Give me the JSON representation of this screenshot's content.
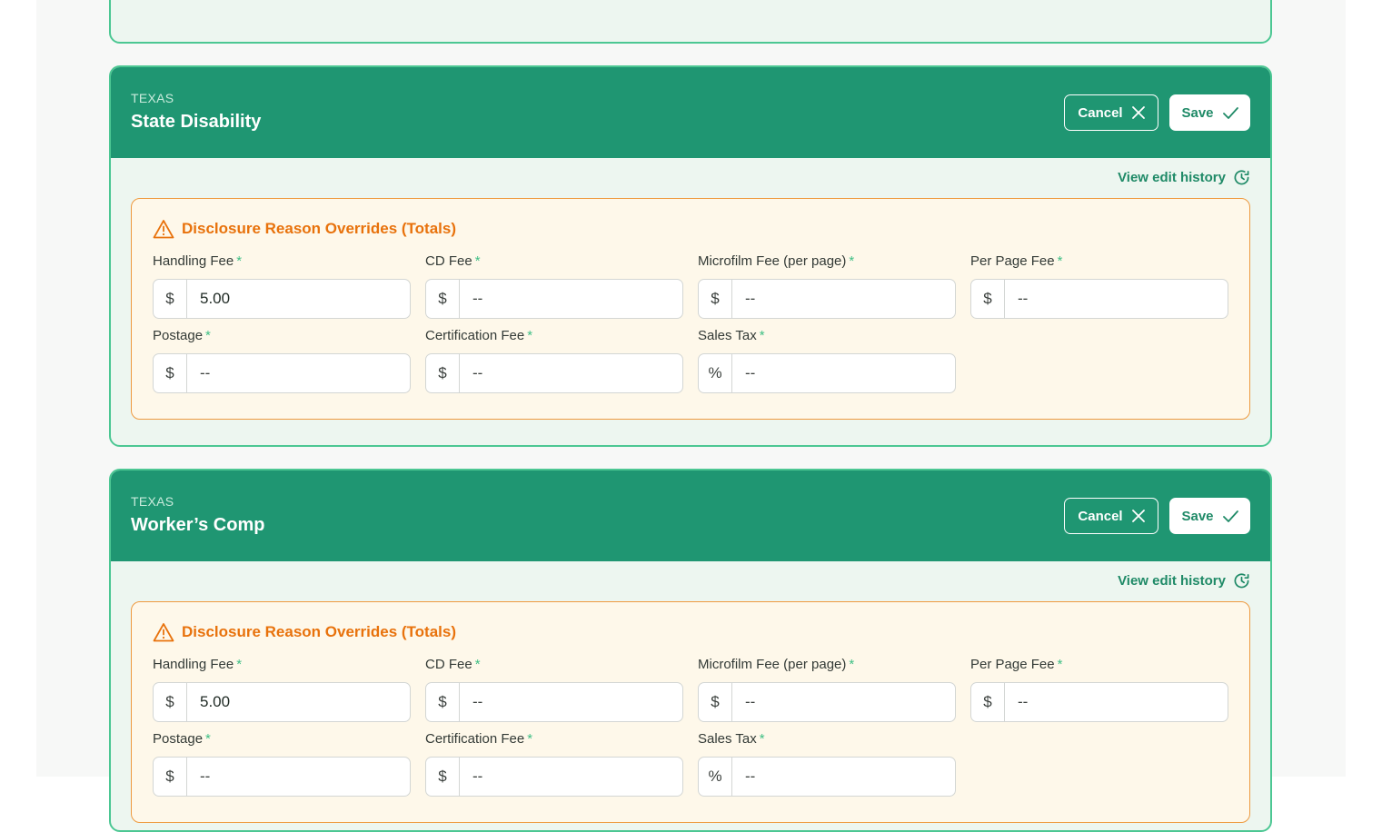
{
  "cards": [
    {
      "state": "TEXAS",
      "title": "State Disability",
      "cancel_label": "Cancel",
      "save_label": "Save",
      "history_label": "View edit history",
      "override_title": "Disclosure Reason Overrides (Totals)",
      "fields": [
        {
          "label": "Handling Fee",
          "prefix": "$",
          "value": "5.00"
        },
        {
          "label": "CD Fee",
          "prefix": "$",
          "value": "--"
        },
        {
          "label": "Microfilm Fee (per page)",
          "prefix": "$",
          "value": "--"
        },
        {
          "label": "Per Page Fee",
          "prefix": "$",
          "value": "--"
        },
        {
          "label": "Postage",
          "prefix": "$",
          "value": "--"
        },
        {
          "label": "Certification Fee",
          "prefix": "$",
          "value": "--"
        },
        {
          "label": "Sales Tax",
          "prefix": "%",
          "value": "--"
        }
      ]
    },
    {
      "state": "TEXAS",
      "title": "Worker’s Comp",
      "cancel_label": "Cancel",
      "save_label": "Save",
      "history_label": "View edit history",
      "override_title": "Disclosure Reason Overrides (Totals)",
      "fields": [
        {
          "label": "Handling Fee",
          "prefix": "$",
          "value": "5.00"
        },
        {
          "label": "CD Fee",
          "prefix": "$",
          "value": "--"
        },
        {
          "label": "Microfilm Fee (per page)",
          "prefix": "$",
          "value": "--"
        },
        {
          "label": "Per Page Fee",
          "prefix": "$",
          "value": "--"
        },
        {
          "label": "Postage",
          "prefix": "$",
          "value": "--"
        },
        {
          "label": "Certification Fee",
          "prefix": "$",
          "value": "--"
        },
        {
          "label": "Sales Tax",
          "prefix": "%",
          "value": "--"
        }
      ]
    }
  ],
  "required_marker": "*",
  "colors": {
    "header_green": "#1f9672",
    "card_border": "#4cc793",
    "card_bg": "#edf6f0",
    "warning_orange": "#e8720c",
    "warning_bg": "#fef8ea"
  }
}
